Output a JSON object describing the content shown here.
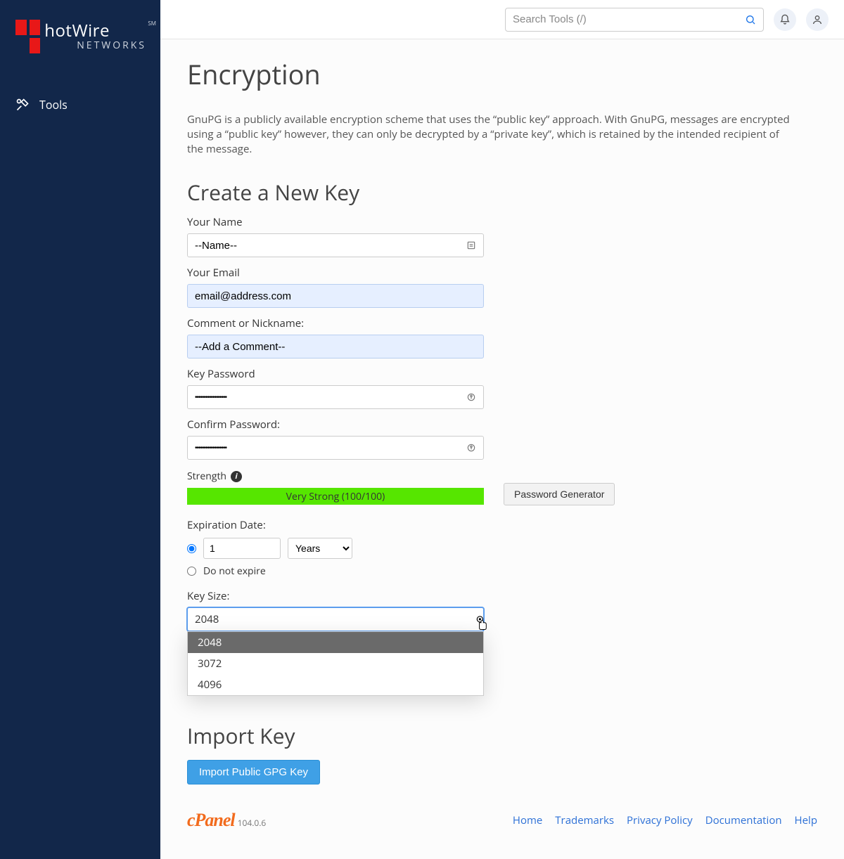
{
  "brand": {
    "name": "hotWire",
    "sub": "NETWORKS",
    "sm": "SM"
  },
  "sidebar": {
    "tools_label": "Tools"
  },
  "search": {
    "placeholder": "Search Tools (/)"
  },
  "page": {
    "title": "Encryption",
    "description": "GnuPG is a publicly available encryption scheme that uses the “public key” approach. With GnuPG, messages are encrypted using a “public key” however, they can only be decrypted by a “private key”, which is retained by the intended recipient of the message."
  },
  "create": {
    "heading": "Create a New Key",
    "name_label": "Your Name",
    "name_value": "--Name--",
    "email_label": "Your Email",
    "email_value": "email@address.com",
    "comment_label": "Comment or Nickname:",
    "comment_value": "--Add a Comment--",
    "pw_label": "Key Password",
    "pw_value": "••••••••••••••••••",
    "pw2_label": "Confirm Password:",
    "pw2_value": "••••••••••••••••••",
    "strength_label": "Strength",
    "strength_text": "Very Strong (100/100)",
    "pwgen_label": "Password Generator",
    "exp_label": "Expiration Date:",
    "exp_value": "1",
    "exp_unit": "Years",
    "exp_noexpire": "Do not expire",
    "keysize_label": "Key Size:",
    "keysize_selected": "2048",
    "keysize_options": [
      "2048",
      "3072",
      "4096"
    ]
  },
  "import": {
    "heading": "Import Key",
    "button": "Import Public GPG Key"
  },
  "footer": {
    "logo": "cPanel",
    "version": "104.0.6",
    "links": [
      "Home",
      "Trademarks",
      "Privacy Policy",
      "Documentation",
      "Help"
    ]
  }
}
